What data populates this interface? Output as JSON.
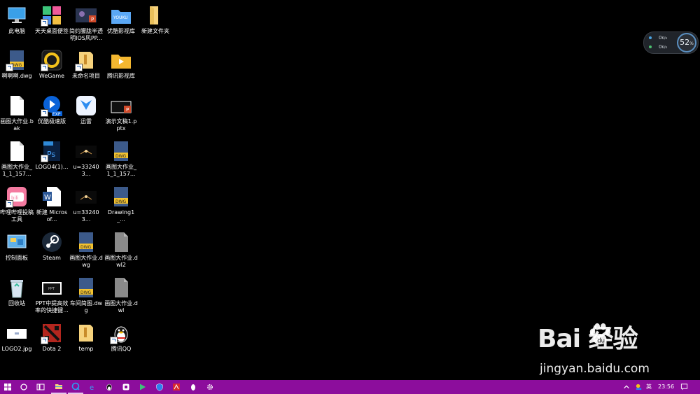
{
  "desktop": {
    "icons": [
      {
        "id": "this-pc",
        "label": "此电脑"
      },
      {
        "id": "tiantian",
        "label": "天天桌面便签"
      },
      {
        "id": "ppt-template",
        "label": "简约朦胧半透明IOS风PP..."
      },
      {
        "id": "youku-lib",
        "label": "优酷影视库"
      },
      {
        "id": "new-folder",
        "label": "新建文件夹"
      },
      {
        "id": "dwg-a",
        "label": "啊啊啊.dwg"
      },
      {
        "id": "wegame",
        "label": "WeGame"
      },
      {
        "id": "untitled",
        "label": "未命名项目"
      },
      {
        "id": "tencent-lib",
        "label": "腾讯影视库"
      },
      {
        "id": "bak-file",
        "label": "画图大作业.bak"
      },
      {
        "id": "youku-exp",
        "label": "优酷极速版"
      },
      {
        "id": "xunlei",
        "label": "迅雷"
      },
      {
        "id": "pptx",
        "label": "演示文稿1.pptx"
      },
      {
        "id": "file-157",
        "label": "画图大作业_1_1_157..."
      },
      {
        "id": "logo4",
        "label": "LOGO4(1)..."
      },
      {
        "id": "u332-a",
        "label": "u=332403..."
      },
      {
        "id": "dwg-157",
        "label": "画图大作业_1_1_157..."
      },
      {
        "id": "bilibili",
        "label": "哔哩哔哩投稿工具"
      },
      {
        "id": "word-new",
        "label": "新建 Microsof..."
      },
      {
        "id": "u332-b",
        "label": "u=332403..."
      },
      {
        "id": "drawing1",
        "label": "Drawing1_..."
      },
      {
        "id": "control-panel",
        "label": "控制面板"
      },
      {
        "id": "steam",
        "label": "Steam"
      },
      {
        "id": "dwg-main",
        "label": "画图大作业.dwg"
      },
      {
        "id": "dwl2",
        "label": "画图大作业.dwl2"
      },
      {
        "id": "recycle",
        "label": "回收站"
      },
      {
        "id": "ppt-tips",
        "label": "PPT中提高效率的快捷键..."
      },
      {
        "id": "workshop",
        "label": "车间简图.dwg"
      },
      {
        "id": "dwl",
        "label": "画图大作业.dwl"
      },
      {
        "id": "logo2",
        "label": "LOGO2.jpg"
      },
      {
        "id": "dota2",
        "label": "Dota 2"
      },
      {
        "id": "temp",
        "label": "temp"
      },
      {
        "id": "qq",
        "label": "腾讯QQ"
      }
    ]
  },
  "speed_widget": {
    "upload": "0",
    "download": "0",
    "unit": "K/s",
    "percent": "52",
    "percent_unit": "%"
  },
  "watermark": {
    "brand": "Bai  经验",
    "url": "jingyan.baidu.com"
  },
  "taskbar": {
    "time": "23:56",
    "ime": "英",
    "accent": "#8c0d9c"
  }
}
